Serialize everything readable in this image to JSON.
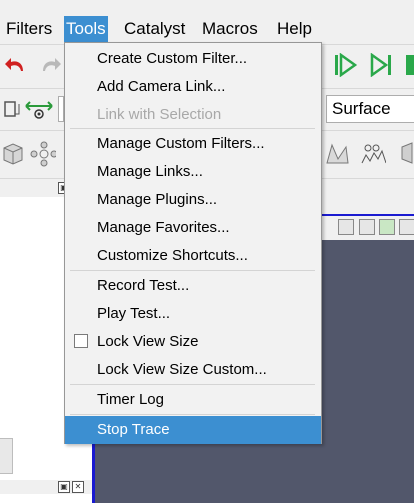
{
  "menubar": {
    "items": [
      {
        "label": "Filters"
      },
      {
        "label": "Tools"
      },
      {
        "label": "Catalyst"
      },
      {
        "label": "Macros"
      },
      {
        "label": "Help"
      }
    ]
  },
  "toolbar": {
    "representation_value": "Surface"
  },
  "tools_menu": {
    "items": [
      {
        "label": "Create Custom Filter..."
      },
      {
        "label": "Add Camera Link..."
      },
      {
        "label": "Link with Selection"
      },
      {
        "label": "Manage Custom Filters..."
      },
      {
        "label": "Manage Links..."
      },
      {
        "label": "Manage Plugins..."
      },
      {
        "label": "Manage Favorites..."
      },
      {
        "label": "Customize Shortcuts..."
      },
      {
        "label": "Record Test..."
      },
      {
        "label": "Play Test..."
      },
      {
        "label": "Lock View Size"
      },
      {
        "label": "Lock View Size Custom..."
      },
      {
        "label": "Timer Log"
      },
      {
        "label": "Stop Trace"
      }
    ]
  },
  "colors": {
    "highlight": "#3c8fd1",
    "render_background": "#52576b",
    "active_view_border": "#1a1ad0",
    "play_green": "#2aa84a",
    "undo_red": "#d02020"
  },
  "icons": [
    "undo-icon",
    "redo-icon",
    "reset-camera-icon",
    "interact-icon",
    "play-icon",
    "last-frame-icon",
    "cube-icon",
    "filter-icon",
    "plot-icon",
    "chart-icon",
    "close-icon",
    "float-icon"
  ]
}
